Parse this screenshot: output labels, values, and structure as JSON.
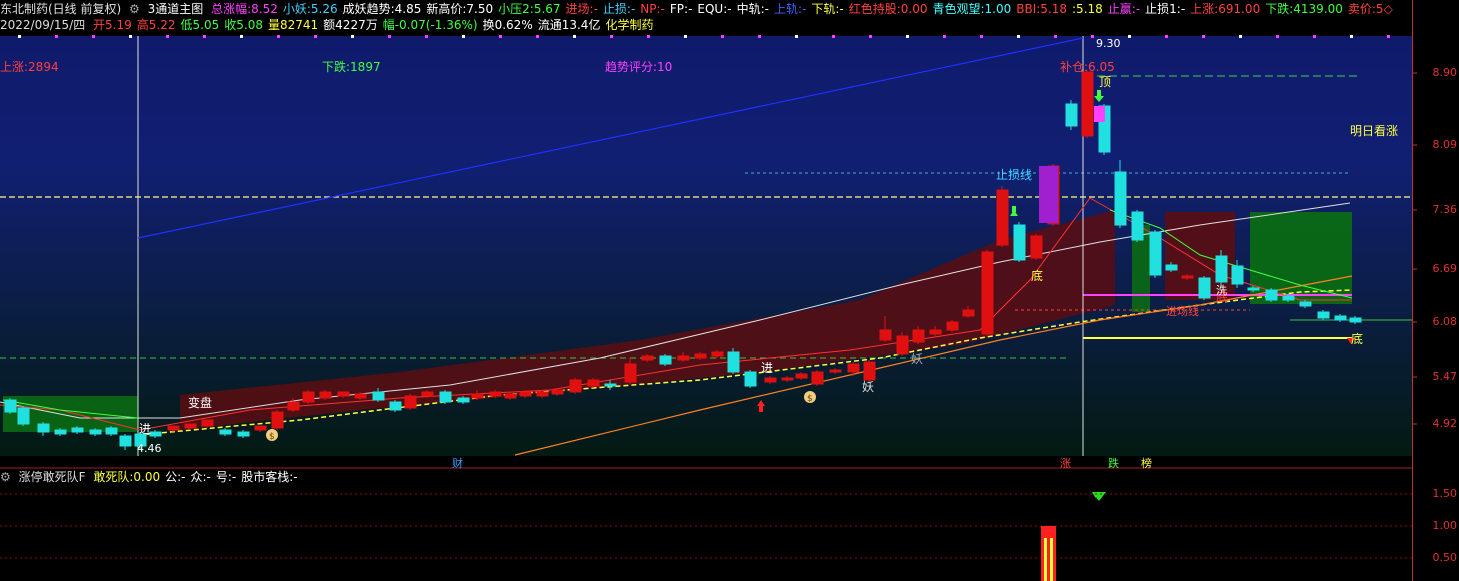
{
  "header": {
    "stock_name": "东北制药(日线 前复权)",
    "indicator_name": "3通道主图",
    "items": [
      {
        "label": "总涨幅:",
        "value": "8.52",
        "color": "#ff40ff"
      },
      {
        "label": "小妖:",
        "value": "5.26",
        "color": "#40d0ff"
      },
      {
        "label": "成妖趋势:",
        "value": "4.85",
        "color": "#ffffff"
      },
      {
        "label": "新高价:",
        "value": "7.50",
        "color": "#ffffff"
      },
      {
        "label": "小压2:",
        "value": "5.67",
        "color": "#40ff40"
      },
      {
        "label": "进场:",
        "value": "-",
        "color": "#ff4040"
      },
      {
        "label": "止损:",
        "value": "-",
        "color": "#40d0ff"
      },
      {
        "label": "NP:",
        "value": "-",
        "color": "#ff4040"
      },
      {
        "label": "FP:",
        "value": "-",
        "color": "#ffffff"
      },
      {
        "label": "EQU:",
        "value": "-",
        "color": "#ffffff"
      },
      {
        "label": "中轨:",
        "value": "-",
        "color": "#ffffff"
      },
      {
        "label": "上轨:",
        "value": "-",
        "color": "#4060ff"
      },
      {
        "label": "下轨:",
        "value": "-",
        "color": "#ffff40"
      },
      {
        "label": "红色持股:",
        "value": "0.00",
        "color": "#ff4040"
      },
      {
        "label": "青色观望:",
        "value": "1.00",
        "color": "#40ffff"
      },
      {
        "label": "BBI:",
        "value": "5.18",
        "color": "#ff4040"
      },
      {
        "label": ":",
        "value": "5.18",
        "color": "#ffff40"
      },
      {
        "label": "止赢:",
        "value": "-",
        "color": "#ff40ff"
      },
      {
        "label": "止损1:",
        "value": "-",
        "color": "#ffffff"
      },
      {
        "label": "上涨:",
        "value": "691.00",
        "color": "#ff4040"
      },
      {
        "label": "下跌:",
        "value": "4139.00",
        "color": "#40ff40"
      },
      {
        "label": "卖价:",
        "value": "5◇",
        "color": "#ff4040"
      }
    ],
    "date": "2022/09/15/四",
    "quote": [
      {
        "label": "开",
        "value": "5.19",
        "color": "#ff4040"
      },
      {
        "label": "高",
        "value": "5.22",
        "color": "#ff4040"
      },
      {
        "label": "低",
        "value": "5.05",
        "color": "#40ff40"
      },
      {
        "label": "收",
        "value": "5.08",
        "color": "#40ff40"
      },
      {
        "label": "量",
        "value": "82741",
        "color": "#ffff40"
      },
      {
        "label": "额",
        "value": "4227万",
        "color": "#ffffff"
      },
      {
        "label": "幅",
        "value": "-0.07(-1.36%)",
        "color": "#40ff40"
      },
      {
        "label": "换",
        "value": "0.62%",
        "color": "#ffffff"
      },
      {
        "label": "流通",
        "value": "13.4亿",
        "color": "#ffffff"
      },
      {
        "label": "",
        "value": "化学制药",
        "color": "#ffff40"
      }
    ]
  },
  "chart": {
    "price_ticks": [
      "8.90",
      "8.09",
      "7.36",
      "6.69",
      "6.08",
      "5.47",
      "4.92"
    ],
    "annotations": {
      "up_count": "上涨:2894",
      "down_count": "下跌:1897",
      "trend_score": "趋势评分:10",
      "buy_add": "补仓:6.05",
      "high_mark": "9.30",
      "low_mark": "4.46",
      "top_label": "顶",
      "stop_line": "止损线",
      "next_day": "明日看涨",
      "bottom1": "底",
      "bottom2": "底",
      "bottom3": "底",
      "change": "变盘",
      "enter1": "进",
      "enter2": "进",
      "monster1": "妖",
      "monster2": "妖",
      "wash": "洗",
      "entry_line": "进场线"
    },
    "date_marks": [
      {
        "text": "财",
        "color": "#40a0ff"
      },
      {
        "text": "涨",
        "color": "#ff4040"
      },
      {
        "text": "跌",
        "color": "#40ff40"
      },
      {
        "text": "榜",
        "color": "#ffff40"
      }
    ]
  },
  "sub_chart": {
    "title": "涨停敢死队F",
    "items": [
      {
        "label": "敢死队:",
        "value": "0.00",
        "color": "#ffff40"
      },
      {
        "label": "公:",
        "value": "-",
        "color": "#ffffff"
      },
      {
        "label": "众:",
        "value": "-",
        "color": "#ffffff"
      },
      {
        "label": "号:",
        "value": "-",
        "color": "#ffffff"
      },
      {
        "label": "股市客栈:",
        "value": "-",
        "color": "#ffffff"
      }
    ],
    "ticks": [
      "1.50",
      "1.00",
      "0.50"
    ]
  },
  "colors": {
    "up": "#e01010",
    "down": "#20e0e0",
    "bg_top": "#0f1a6b",
    "bg_bottom": "#031a12"
  }
}
